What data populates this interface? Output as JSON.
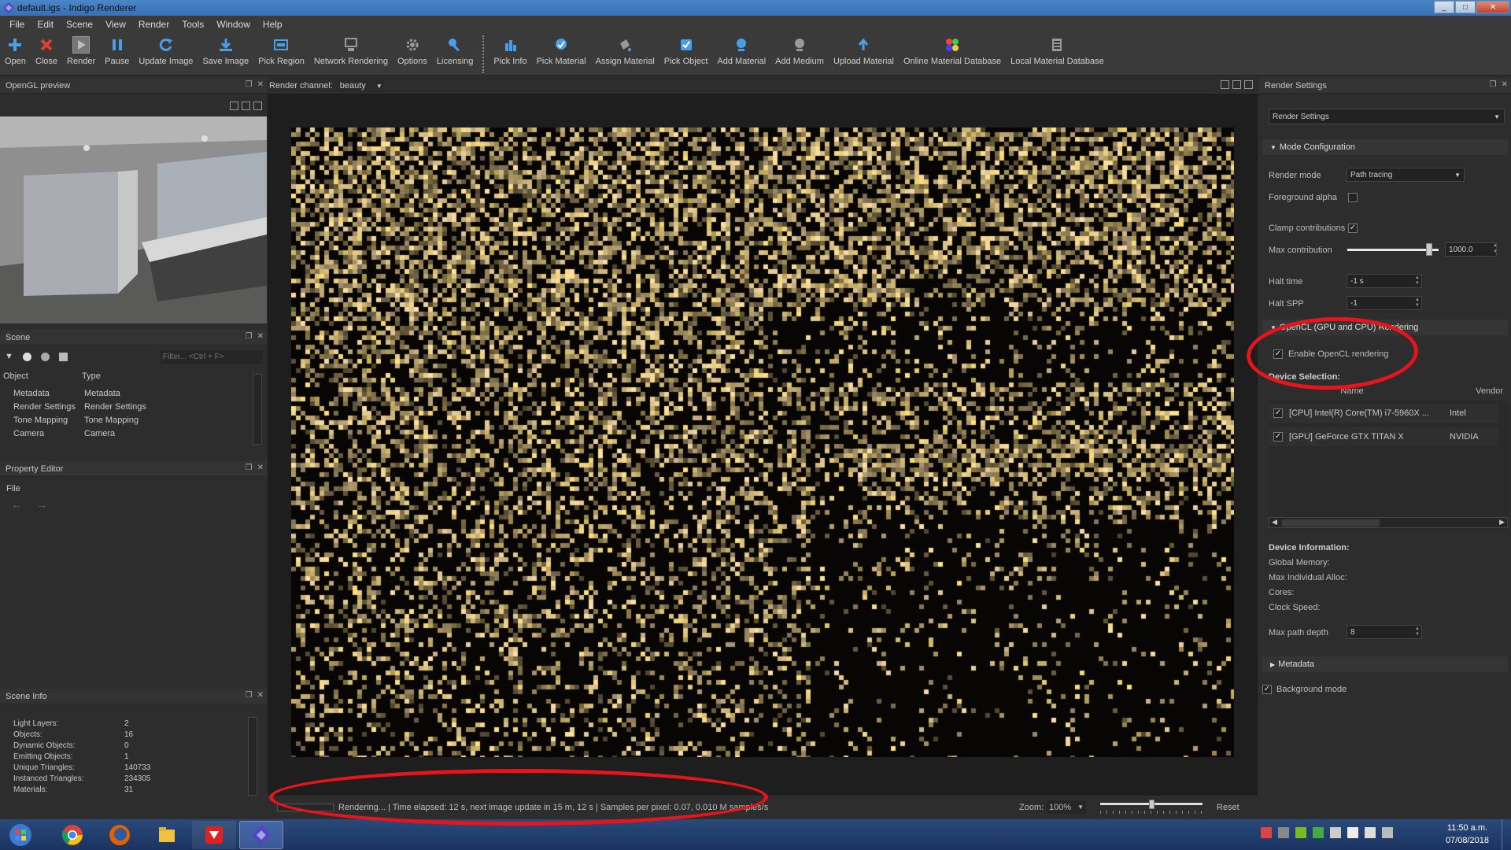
{
  "window": {
    "title": "default.igs - Indigo Renderer"
  },
  "menu": [
    "File",
    "Edit",
    "Scene",
    "View",
    "Render",
    "Tools",
    "Window",
    "Help"
  ],
  "toolbar": {
    "group1": [
      {
        "label": "Open",
        "icon": "plus-icon"
      },
      {
        "label": "Close",
        "icon": "close-icon"
      },
      {
        "label": "Render",
        "icon": "play-icon"
      },
      {
        "label": "Pause",
        "icon": "pause-icon"
      },
      {
        "label": "Update Image",
        "icon": "refresh-icon"
      },
      {
        "label": "Save Image",
        "icon": "save-image-icon"
      },
      {
        "label": "Pick Region",
        "icon": "pick-region-icon"
      },
      {
        "label": "Network Rendering",
        "icon": "network-icon"
      },
      {
        "label": "Options",
        "icon": "gear-icon"
      },
      {
        "label": "Licensing",
        "icon": "key-icon"
      }
    ],
    "group2": [
      {
        "label": "Pick Info",
        "icon": "bar-chart-icon"
      },
      {
        "label": "Pick Material",
        "icon": "pick-material-icon"
      },
      {
        "label": "Assign Material",
        "icon": "bucket-icon"
      },
      {
        "label": "Pick Object",
        "icon": "pick-object-icon"
      },
      {
        "label": "Add Material",
        "icon": "add-material-icon"
      },
      {
        "label": "Add Medium",
        "icon": "add-medium-icon"
      },
      {
        "label": "Upload Material",
        "icon": "upload-icon"
      },
      {
        "label": "Online Material Database",
        "icon": "online-db-icon"
      },
      {
        "label": "Local Material Database",
        "icon": "local-db-icon"
      }
    ]
  },
  "opengl": {
    "title": "OpenGL preview"
  },
  "scene": {
    "title": "Scene",
    "filter_placeholder": "Filter... <Ctrl + F>",
    "col_object": "Object",
    "col_type": "Type",
    "rows": [
      {
        "object": "Metadata",
        "type": "Metadata"
      },
      {
        "object": "Render Settings",
        "type": "Render Settings"
      },
      {
        "object": "Tone Mapping",
        "type": "Tone Mapping"
      },
      {
        "object": "Camera",
        "type": "Camera"
      }
    ]
  },
  "property_editor": {
    "title": "Property Editor",
    "file_label": "File"
  },
  "scene_info": {
    "title": "Scene Info",
    "rows": [
      {
        "label": "Light Layers:",
        "value": "2"
      },
      {
        "label": "Objects:",
        "value": "16"
      },
      {
        "label": "Dynamic Objects:",
        "value": "0"
      },
      {
        "label": "Emitting Objects:",
        "value": "1"
      },
      {
        "label": "Unique Triangles:",
        "value": "140733"
      },
      {
        "label": "Instanced Triangles:",
        "value": "234305"
      },
      {
        "label": "Materials:",
        "value": "31"
      }
    ]
  },
  "render_channel": {
    "label": "Render channel:",
    "value": "beauty"
  },
  "render_settings": {
    "title": "Render Settings",
    "preset": "Render Settings",
    "mode_configuration": "Mode Configuration",
    "render_mode_label": "Render mode",
    "render_mode_value": "Path tracing",
    "foreground_alpha_label": "Foreground alpha",
    "foreground_alpha": false,
    "clamp_label": "Clamp contributions",
    "clamp": true,
    "max_contribution_label": "Max contribution",
    "max_contribution_value": "1000.0",
    "max_contribution_slider": 0.93,
    "halt_time_label": "Halt time",
    "halt_time_value": "-1 s",
    "halt_spp_label": "Halt SPP",
    "halt_spp_value": "-1",
    "opencl_section": "OpenCL (GPU and CPU) Rendering",
    "enable_opencl_label": "Enable OpenCL rendering",
    "enable_opencl": true,
    "device_selection": "Device Selection:",
    "col_name": "Name",
    "col_vendor": "Vendor",
    "devices": [
      {
        "name": "[CPU] Intel(R) Core(TM) i7-5960X ...",
        "vendor": "Intel",
        "checked": true
      },
      {
        "name": "[GPU] GeForce GTX TITAN X",
        "vendor": "NVIDIA",
        "checked": true
      }
    ],
    "device_information": "Device Information:",
    "global_memory": "Global Memory:",
    "max_alloc": "Max Individual Alloc:",
    "cores": "Cores:",
    "clock_speed": "Clock Speed:",
    "max_path_depth_label": "Max path depth",
    "max_path_depth_value": "8",
    "metadata_section": "Metadata",
    "background_mode_label": "Background mode",
    "background_mode": true
  },
  "status": {
    "text": "Rendering... | Time elapsed: 12 s, next image update in 15 m, 12 s | Samples per pixel: 0.07, 0.010 M samples/s",
    "zoom_label": "Zoom:",
    "zoom_value": "100%",
    "reset": "Reset",
    "zoom_slider": 0.5
  },
  "taskbar": {
    "apps": [
      "start-orb-icon",
      "chrome-icon",
      "firefox-icon",
      "file-explorer-icon",
      "sketchup-icon",
      "indigo-icon"
    ],
    "time": "11:50 a.m.",
    "date": "07/08/2018"
  },
  "colors": {
    "annotation": "#e8141c",
    "accent": "#3a6fb0"
  }
}
